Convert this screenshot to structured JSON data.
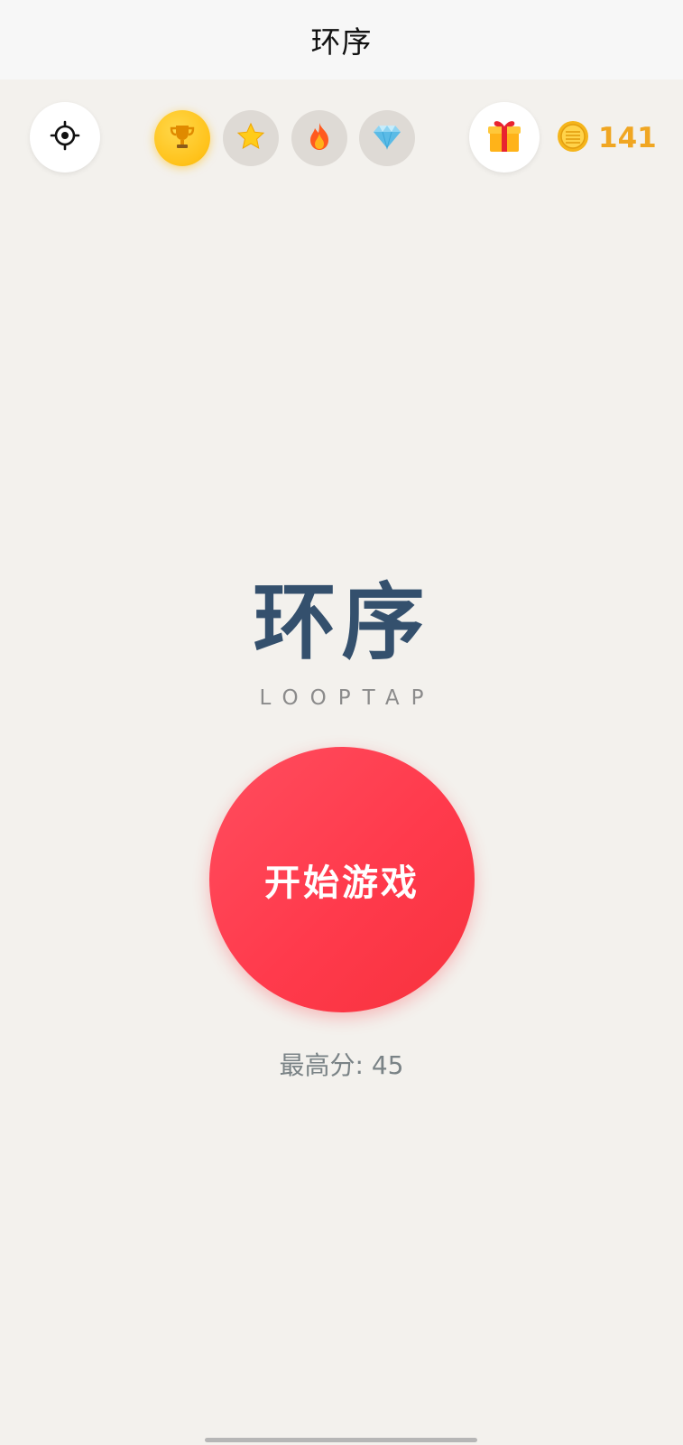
{
  "app_title": "环序",
  "header": {
    "settings_icon": "gear-icon",
    "achievements": [
      {
        "name": "trophy-icon",
        "active": true
      },
      {
        "name": "star-icon",
        "active": false
      },
      {
        "name": "fire-icon",
        "active": false
      },
      {
        "name": "diamond-icon",
        "active": false
      }
    ],
    "gift_icon": "gift-icon",
    "coin_icon": "coin-icon",
    "coins": "141"
  },
  "main": {
    "title": "环序",
    "subtitle": "LOOPTAP",
    "start_label": "开始游戏",
    "best_score": "最高分: 45"
  },
  "colors": {
    "background": "#f3f1ed",
    "title": "#34506d",
    "start_button": "#ff4050",
    "coin_text": "#f0a622",
    "active_badge": "#ffc21a",
    "inactive_badge": "#dedad5"
  }
}
